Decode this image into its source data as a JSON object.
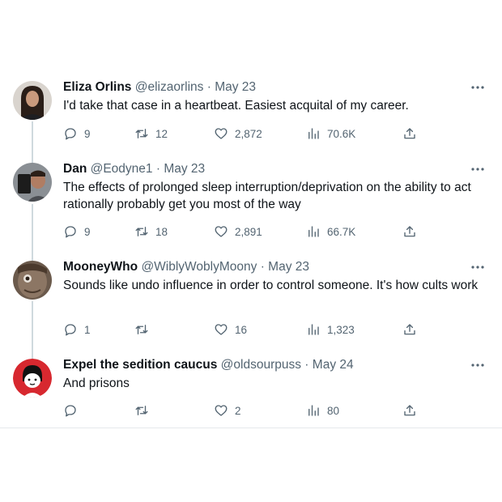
{
  "tweets": [
    {
      "name": "Eliza Orlins",
      "handle": "@elizaorlins",
      "date": "May 23",
      "text": "I'd take that case in a heartbeat. Easiest acquital of my career.",
      "replies": "9",
      "retweets": "12",
      "likes": "2,872",
      "views": "70.6K"
    },
    {
      "name": "Dan",
      "handle": "@Eodyne1",
      "date": "May 23",
      "text": "The effects of prolonged sleep interruption/deprivation on the ability to act rationally probably get you most of the way",
      "replies": "9",
      "retweets": "18",
      "likes": "2,891",
      "views": "66.7K"
    },
    {
      "name": "MooneyWho",
      "handle": "@WiblyWoblyMoony",
      "date": "May 23",
      "text": "Sounds like undo influence in order to control someone. It's how cults work",
      "replies": "1",
      "retweets": "",
      "likes": "16",
      "views": "1,323"
    },
    {
      "name": "Expel the sedition caucus",
      "handle": "@oldsourpuss",
      "date": "May 24",
      "text": "And prisons",
      "replies": "",
      "retweets": "",
      "likes": "2",
      "views": "80"
    }
  ],
  "separator": "·",
  "icons": {
    "more": "more-horizontal-icon",
    "reply": "reply-bubble-icon",
    "retweet": "retweet-icon",
    "like": "heart-icon",
    "views": "views-bar-chart-icon",
    "share": "share-icon"
  },
  "colors": {
    "text_primary": "#0f1419",
    "text_secondary": "#536471",
    "thread_line": "#cfd9de"
  }
}
